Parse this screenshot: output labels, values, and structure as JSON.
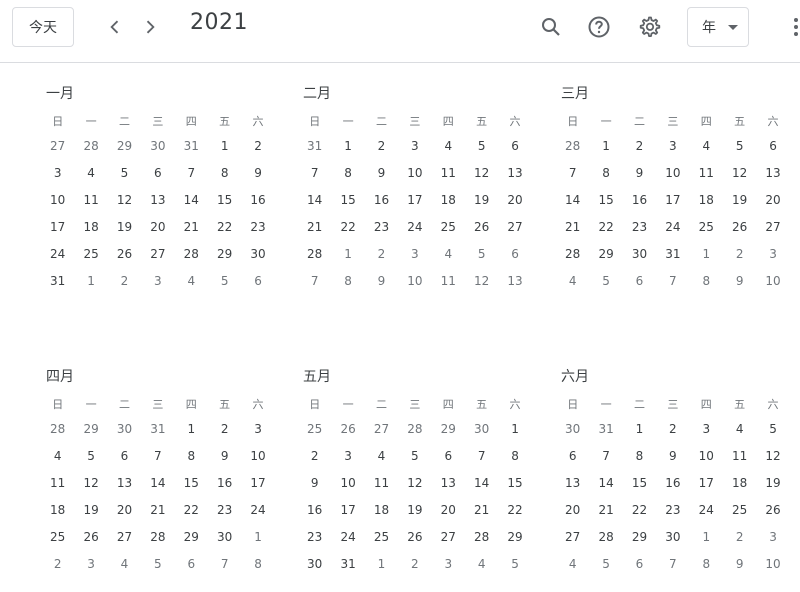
{
  "header": {
    "today_label": "今天",
    "year": "2021",
    "view_label": "年"
  },
  "weekdays": [
    "日",
    "一",
    "二",
    "三",
    "四",
    "五",
    "六"
  ],
  "months": [
    {
      "name": "一月",
      "weeks": [
        [
          "27",
          "28",
          "29",
          "30",
          "31",
          "1",
          "2"
        ],
        [
          "3",
          "4",
          "5",
          "6",
          "7",
          "8",
          "9"
        ],
        [
          "10",
          "11",
          "12",
          "13",
          "14",
          "15",
          "16"
        ],
        [
          "17",
          "18",
          "19",
          "20",
          "21",
          "22",
          "23"
        ],
        [
          "24",
          "25",
          "26",
          "27",
          "28",
          "29",
          "30"
        ],
        [
          "31",
          "1",
          "2",
          "3",
          "4",
          "5",
          "6"
        ]
      ],
      "lead": 5,
      "days": 31
    },
    {
      "name": "二月",
      "weeks": [
        [
          "31",
          "1",
          "2",
          "3",
          "4",
          "5",
          "6"
        ],
        [
          "7",
          "8",
          "9",
          "10",
          "11",
          "12",
          "13"
        ],
        [
          "14",
          "15",
          "16",
          "17",
          "18",
          "19",
          "20"
        ],
        [
          "21",
          "22",
          "23",
          "24",
          "25",
          "26",
          "27"
        ],
        [
          "28",
          "1",
          "2",
          "3",
          "4",
          "5",
          "6"
        ],
        [
          "7",
          "8",
          "9",
          "10",
          "11",
          "12",
          "13"
        ]
      ],
      "lead": 1,
      "days": 28
    },
    {
      "name": "三月",
      "weeks": [
        [
          "28",
          "1",
          "2",
          "3",
          "4",
          "5",
          "6"
        ],
        [
          "7",
          "8",
          "9",
          "10",
          "11",
          "12",
          "13"
        ],
        [
          "14",
          "15",
          "16",
          "17",
          "18",
          "19",
          "20"
        ],
        [
          "21",
          "22",
          "23",
          "24",
          "25",
          "26",
          "27"
        ],
        [
          "28",
          "29",
          "30",
          "31",
          "1",
          "2",
          "3"
        ],
        [
          "4",
          "5",
          "6",
          "7",
          "8",
          "9",
          "10"
        ]
      ],
      "lead": 1,
      "days": 31
    },
    {
      "name": "四月",
      "weeks": [
        [
          "28",
          "29",
          "30",
          "31",
          "1",
          "2",
          "3"
        ],
        [
          "4",
          "5",
          "6",
          "7",
          "8",
          "9",
          "10"
        ],
        [
          "11",
          "12",
          "13",
          "14",
          "15",
          "16",
          "17"
        ],
        [
          "18",
          "19",
          "20",
          "21",
          "22",
          "23",
          "24"
        ],
        [
          "25",
          "26",
          "27",
          "28",
          "29",
          "30",
          "1"
        ],
        [
          "2",
          "3",
          "4",
          "5",
          "6",
          "7",
          "8"
        ]
      ],
      "lead": 4,
      "days": 30
    },
    {
      "name": "五月",
      "weeks": [
        [
          "25",
          "26",
          "27",
          "28",
          "29",
          "30",
          "1"
        ],
        [
          "2",
          "3",
          "4",
          "5",
          "6",
          "7",
          "8"
        ],
        [
          "9",
          "10",
          "11",
          "12",
          "13",
          "14",
          "15"
        ],
        [
          "16",
          "17",
          "18",
          "19",
          "20",
          "21",
          "22"
        ],
        [
          "23",
          "24",
          "25",
          "26",
          "27",
          "28",
          "29"
        ],
        [
          "30",
          "31",
          "1",
          "2",
          "3",
          "4",
          "5"
        ]
      ],
      "lead": 6,
      "days": 31
    },
    {
      "name": "六月",
      "weeks": [
        [
          "30",
          "31",
          "1",
          "2",
          "3",
          "4",
          "5"
        ],
        [
          "6",
          "7",
          "8",
          "9",
          "10",
          "11",
          "12"
        ],
        [
          "13",
          "14",
          "15",
          "16",
          "17",
          "18",
          "19"
        ],
        [
          "20",
          "21",
          "22",
          "23",
          "24",
          "25",
          "26"
        ],
        [
          "27",
          "28",
          "29",
          "30",
          "1",
          "2",
          "3"
        ],
        [
          "4",
          "5",
          "6",
          "7",
          "8",
          "9",
          "10"
        ]
      ],
      "lead": 2,
      "days": 30
    }
  ]
}
